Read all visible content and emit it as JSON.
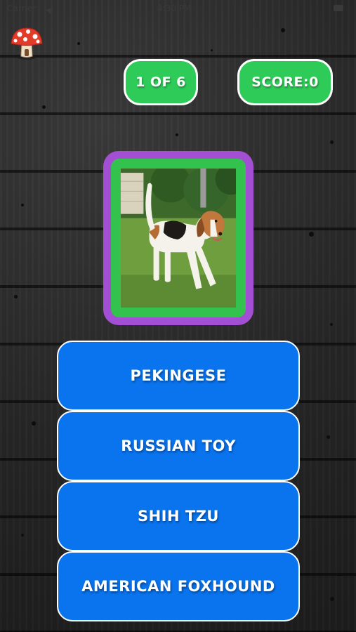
{
  "status_bar": {
    "carrier": "Carrier",
    "time": "4:30 PM"
  },
  "header": {
    "progress": "1 OF 6",
    "score": "SCORE:0"
  },
  "icons": {
    "mushroom": "mushroom-icon",
    "wifi": "wifi-icon",
    "battery": "battery-icon"
  },
  "answers": [
    "PEKINGESE",
    "RUSSIAN TOY",
    "SHIH TZU",
    "AMERICAN FOXHOUND"
  ],
  "colors": {
    "badge_green": "#2ecb58",
    "frame_purple": "#a24fd4",
    "frame_green": "#33c24d",
    "answer_blue": "#0a74ef"
  }
}
